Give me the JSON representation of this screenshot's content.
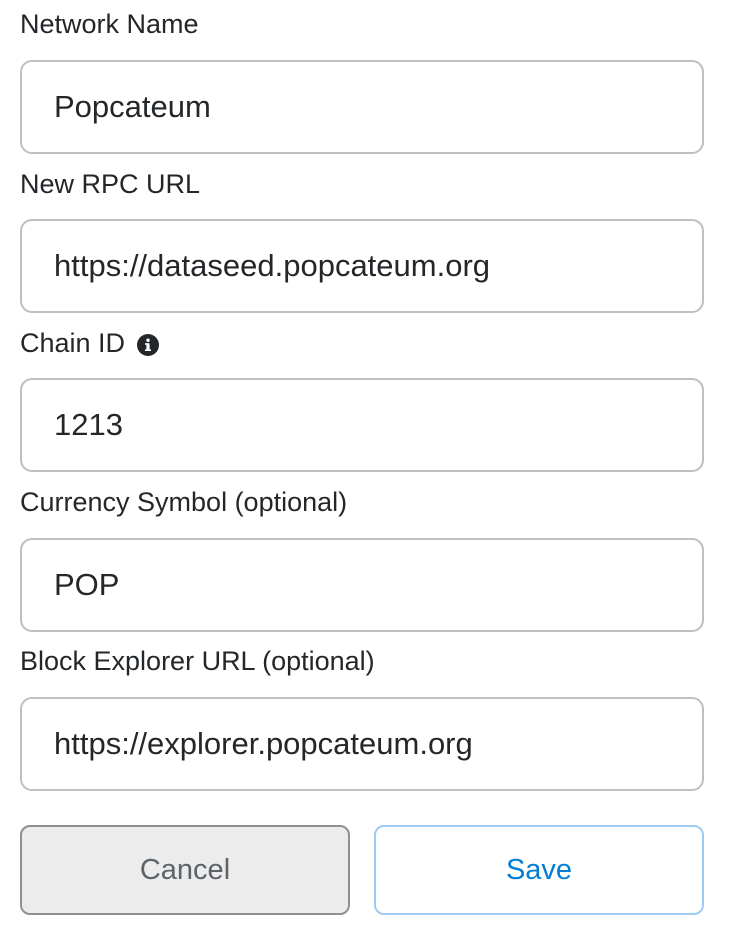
{
  "form": {
    "network_name": {
      "label": "Network Name",
      "value": "Popcateum"
    },
    "rpc_url": {
      "label": "New RPC URL",
      "value": "https://dataseed.popcateum.org"
    },
    "chain_id": {
      "label": "Chain ID",
      "value": "1213",
      "info_icon": "info-circle-icon"
    },
    "currency_symbol": {
      "label": "Currency Symbol (optional)",
      "value": "POP"
    },
    "block_explorer_url": {
      "label": "Block Explorer URL (optional)",
      "value": "https://explorer.popcateum.org"
    }
  },
  "actions": {
    "cancel_label": "Cancel",
    "save_label": "Save"
  },
  "colors": {
    "text": "#24272a",
    "input_border": "#bbc0c5",
    "cancel_bg": "#ececec",
    "save_text": "#037dd6",
    "save_border": "#9fcaf3"
  }
}
